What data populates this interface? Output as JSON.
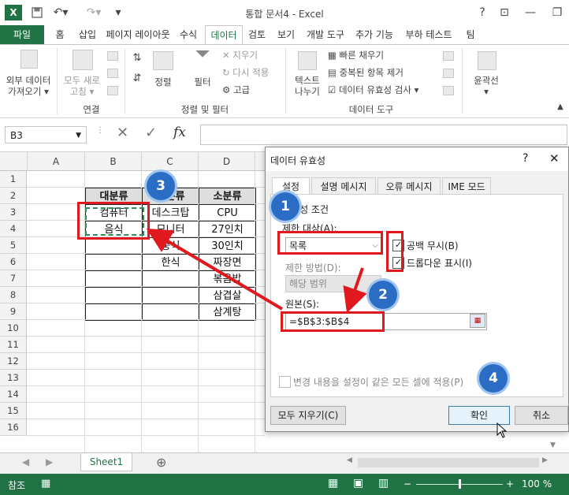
{
  "window": {
    "title": "통합 문서4 - Excel",
    "logo": "X",
    "help": "?",
    "min": "—",
    "restore": "❐",
    "ribbon_opt": "⊡"
  },
  "tabs": [
    "파일",
    "홈",
    "삽입",
    "페이지 레이아웃",
    "수식",
    "데이터",
    "검토",
    "보기",
    "개발 도구",
    "추가 기능",
    "부하 테스트",
    "팀"
  ],
  "ribbon": {
    "external": "외부 데이터\n가져오기 ▾",
    "refresh": "모두 새로\n고침 ▾",
    "group_conn": "연결",
    "sort": "정렬",
    "filter": "필터",
    "clear": "지우기",
    "reapply": "다시 적용",
    "advanced": "고급",
    "group_sort": "정렬 및 필터",
    "text_cols": "텍스트\n나누기",
    "flash": "빠른 채우기",
    "dup": "중복된 항목 제거",
    "validation": "데이터 유효성 검사 ▾",
    "group_tools": "데이터 도구",
    "outline": "윤곽선\n▾"
  },
  "formula_bar": {
    "name_box": "B3",
    "cancel": "✕",
    "enter": "✓",
    "fx": "fx"
  },
  "grid": {
    "columns": [
      "A",
      "B",
      "C",
      "D"
    ],
    "rows": [
      "1",
      "2",
      "3",
      "4",
      "5",
      "6",
      "7",
      "8",
      "9",
      "10",
      "11",
      "12",
      "13",
      "14",
      "15",
      "16"
    ],
    "table": {
      "header": [
        "대분류",
        "중분류",
        "소분류"
      ],
      "b": [
        "컴퓨터",
        "음식",
        "",
        "",
        "",
        "",
        ""
      ],
      "c": [
        "데스크탑",
        "모니터",
        "중식",
        "한식",
        "",
        "",
        ""
      ],
      "d": [
        "CPU",
        "27인치",
        "30인치",
        "짜장면",
        "볶음밥",
        "삼겹살",
        "삼계탕"
      ]
    }
  },
  "sheets": {
    "active": "Sheet1",
    "add": "⊕"
  },
  "status": {
    "ready": "참조",
    "zoom": "100 %"
  },
  "dialog": {
    "title": "데이터 유효성",
    "help": "?",
    "close": "✕",
    "tabs": [
      "설정",
      "설명 메시지",
      "오류 메시지",
      "IME 모드"
    ],
    "criteria_label": "유효성 조건",
    "allow_label": "제한 대상(A):",
    "allow_value": "목록",
    "ignore_blank": "공백 무시(B)",
    "dropdown": "드롭다운 표시(I)",
    "data_label": "제한 방법(D):",
    "data_value": "해당 범위",
    "source_label": "원본(S):",
    "source_value": "=$B$3:$B$4",
    "apply_all": "변경 내용을 설정이 같은 모든 셀에 적용(P)",
    "clear_all": "모두 지우기(C)",
    "ok": "확인",
    "cancel": "취소"
  },
  "badges": [
    "1",
    "2",
    "3",
    "4"
  ],
  "colors": {
    "excel_green": "#217346",
    "highlight_red": "#e0191f",
    "badge_blue": "#2b6cc4"
  }
}
